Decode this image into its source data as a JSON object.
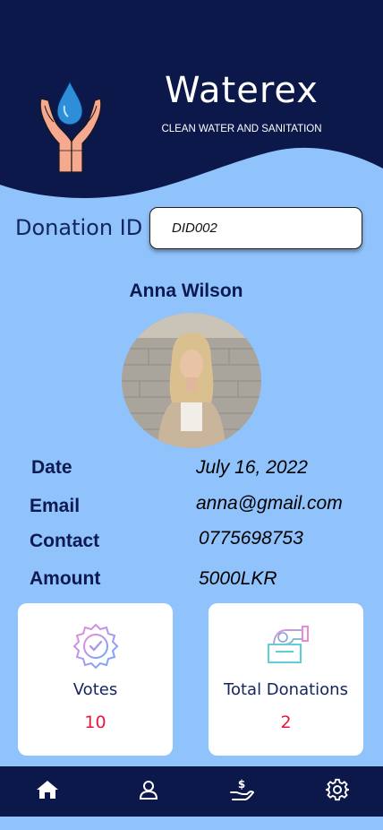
{
  "app": {
    "name": "Waterex",
    "tagline": "CLEAN WATER AND SANITATION"
  },
  "donation": {
    "id_label": "Donation ID",
    "id_value": "DID002"
  },
  "donor": {
    "name": "Anna Wilson",
    "details": [
      {
        "label": "Date",
        "value": "July 16, 2022"
      },
      {
        "label": "Email",
        "value": "anna@gmail.com"
      },
      {
        "label": "Contact",
        "value": "0775698753"
      },
      {
        "label": "Amount",
        "value": "5000LKR"
      }
    ]
  },
  "stats": {
    "votes": {
      "label": "Votes",
      "count": "10"
    },
    "total_donations": {
      "label": "Total Donations",
      "count": "2"
    }
  },
  "nav": {
    "items": [
      {
        "icon": "home-icon"
      },
      {
        "icon": "user-icon"
      },
      {
        "icon": "donate-icon"
      },
      {
        "icon": "settings-icon"
      }
    ]
  },
  "colors": {
    "header_navy": "#0b1849",
    "background": "#90c2fb",
    "accent_red": "#e8173c"
  }
}
